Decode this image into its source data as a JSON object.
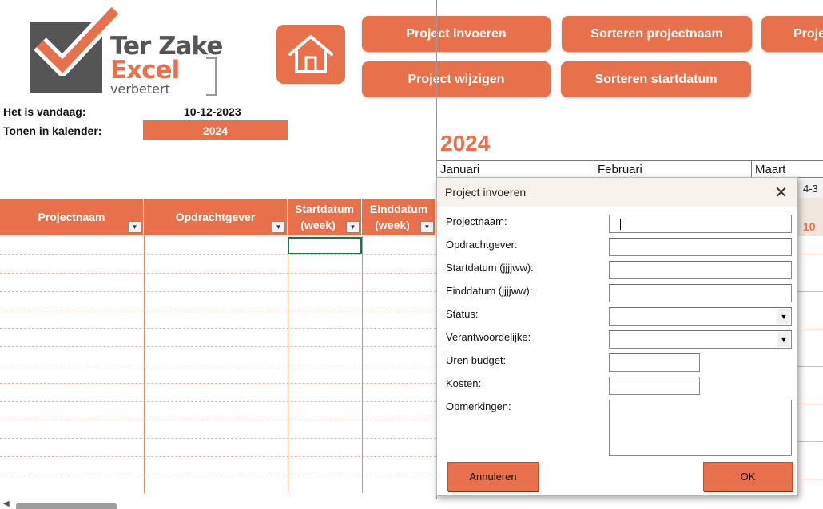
{
  "logo": {
    "line1": "Ter Zake",
    "line2": "Excel",
    "line3": "verbetert"
  },
  "buttons": {
    "project_invoeren": "Project invoeren",
    "sorteren_projectnaam": "Sorteren projectnaam",
    "project_cut": "Proje",
    "project_wijzigen": "Project wijzigen",
    "sorteren_startdatum": "Sorteren startdatum"
  },
  "info": {
    "today_label": "Het is vandaag:",
    "today_value": "10-12-2023",
    "calendar_label": "Tonen in kalender:",
    "calendar_value": "2024"
  },
  "calendar": {
    "year": "2024",
    "months": [
      "Januari",
      "Februari",
      "Maart"
    ],
    "week_header_partial": "4-3",
    "week_value_partial": "10"
  },
  "table": {
    "headers": {
      "projectnaam": "Projectnaam",
      "opdrachtgever": "Opdrachtgever",
      "startdatum_1": "Startdatum",
      "startdatum_2": "(week)",
      "einddatum_1": "Einddatum",
      "einddatum_2": "(week)"
    }
  },
  "dialog": {
    "title": "Project invoeren",
    "close": "✕",
    "fields": {
      "projectnaam": "Projectnaam:",
      "opdrachtgever": "Opdrachtgever:",
      "startdatum": "Startdatum (jjjjww):",
      "einddatum": "Einddatum (jjjjww):",
      "status": "Status:",
      "verantwoordelijke": "Verantwoordelijke:",
      "uren_budget": "Uren budget:",
      "kosten": "Kosten:",
      "opmerkingen": "Opmerkingen:"
    },
    "cancel": "Annuleren",
    "ok": "OK"
  },
  "icons": {
    "home": "home-icon",
    "dropdown": "chevron-down-icon",
    "close": "close-icon",
    "check": "checkmark-icon"
  },
  "colors": {
    "accent": "#e8704a",
    "logo_gray": "#555555",
    "dialog_title_bg": "#f7f3ec"
  }
}
